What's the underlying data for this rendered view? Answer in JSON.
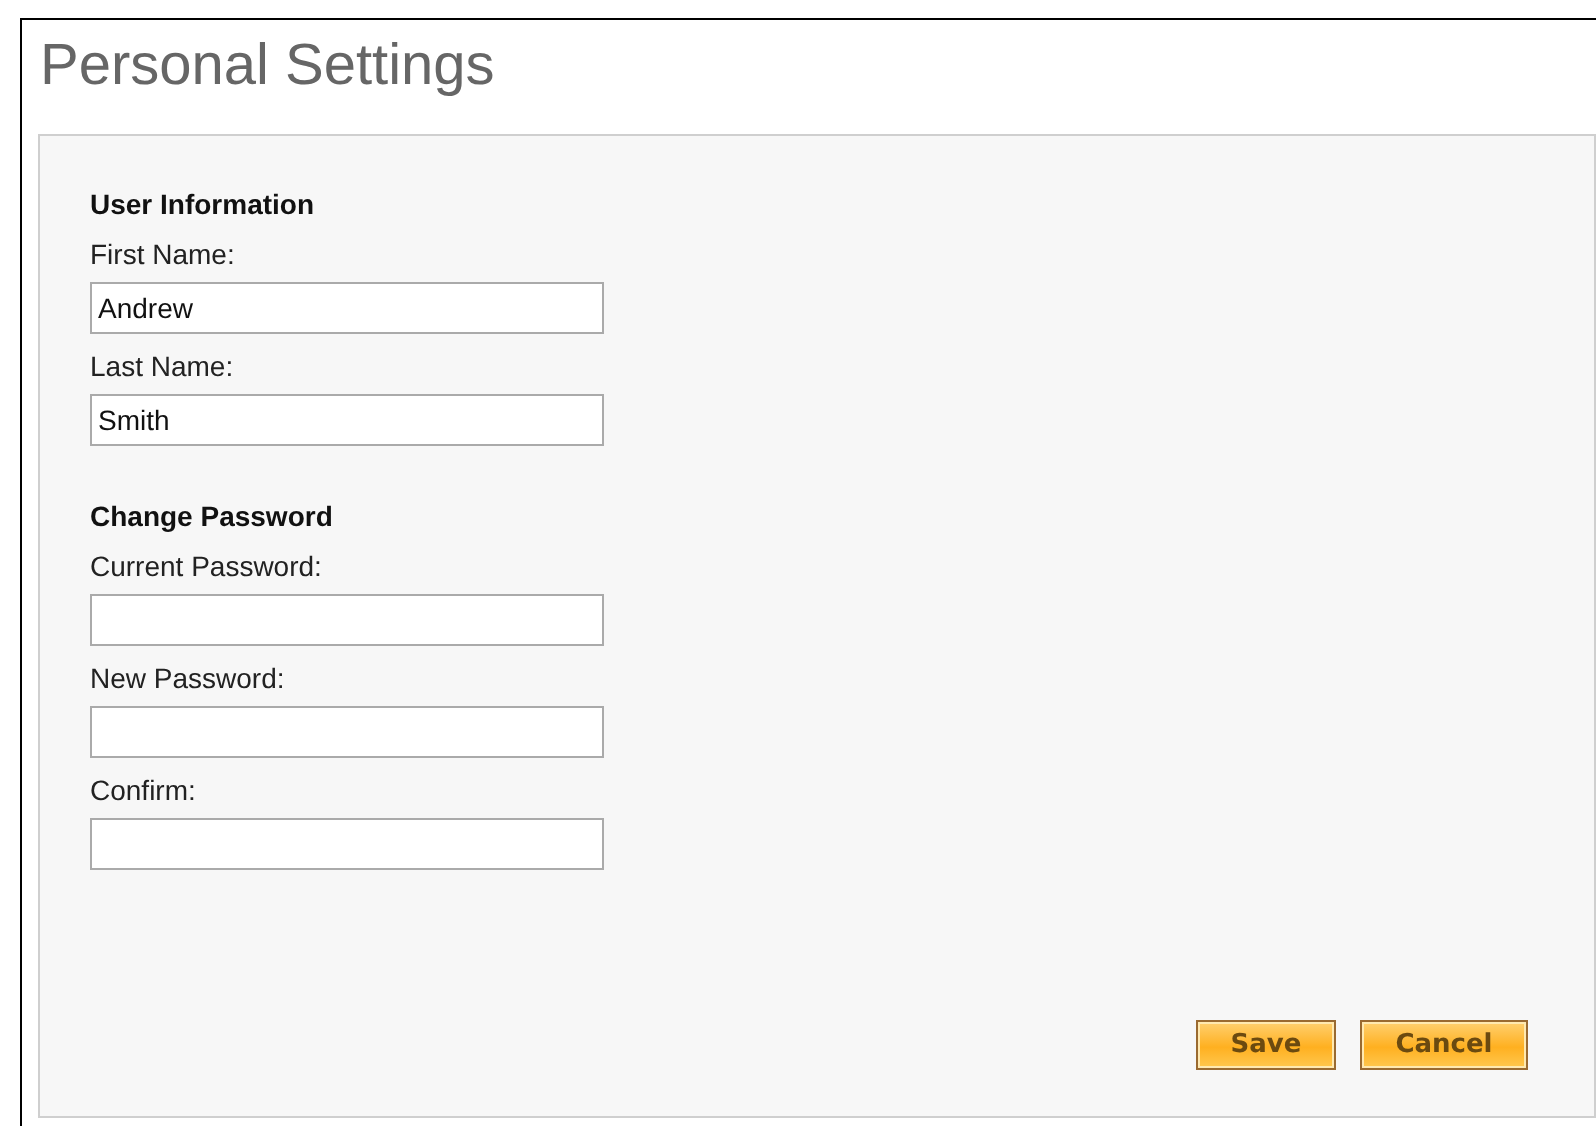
{
  "title": "Personal Settings",
  "sections": [
    {
      "heading": "User Information",
      "fields": [
        {
          "label": "First Name:",
          "value": "Andrew"
        },
        {
          "label": "Last Name:",
          "value": "Smith"
        }
      ]
    },
    {
      "heading": "Change Password",
      "fields": [
        {
          "label": "Current Password:"
        },
        {
          "label": "New Password:"
        },
        {
          "label": "Confirm:"
        }
      ]
    }
  ],
  "buttons": [
    "Save",
    "Cancel"
  ]
}
